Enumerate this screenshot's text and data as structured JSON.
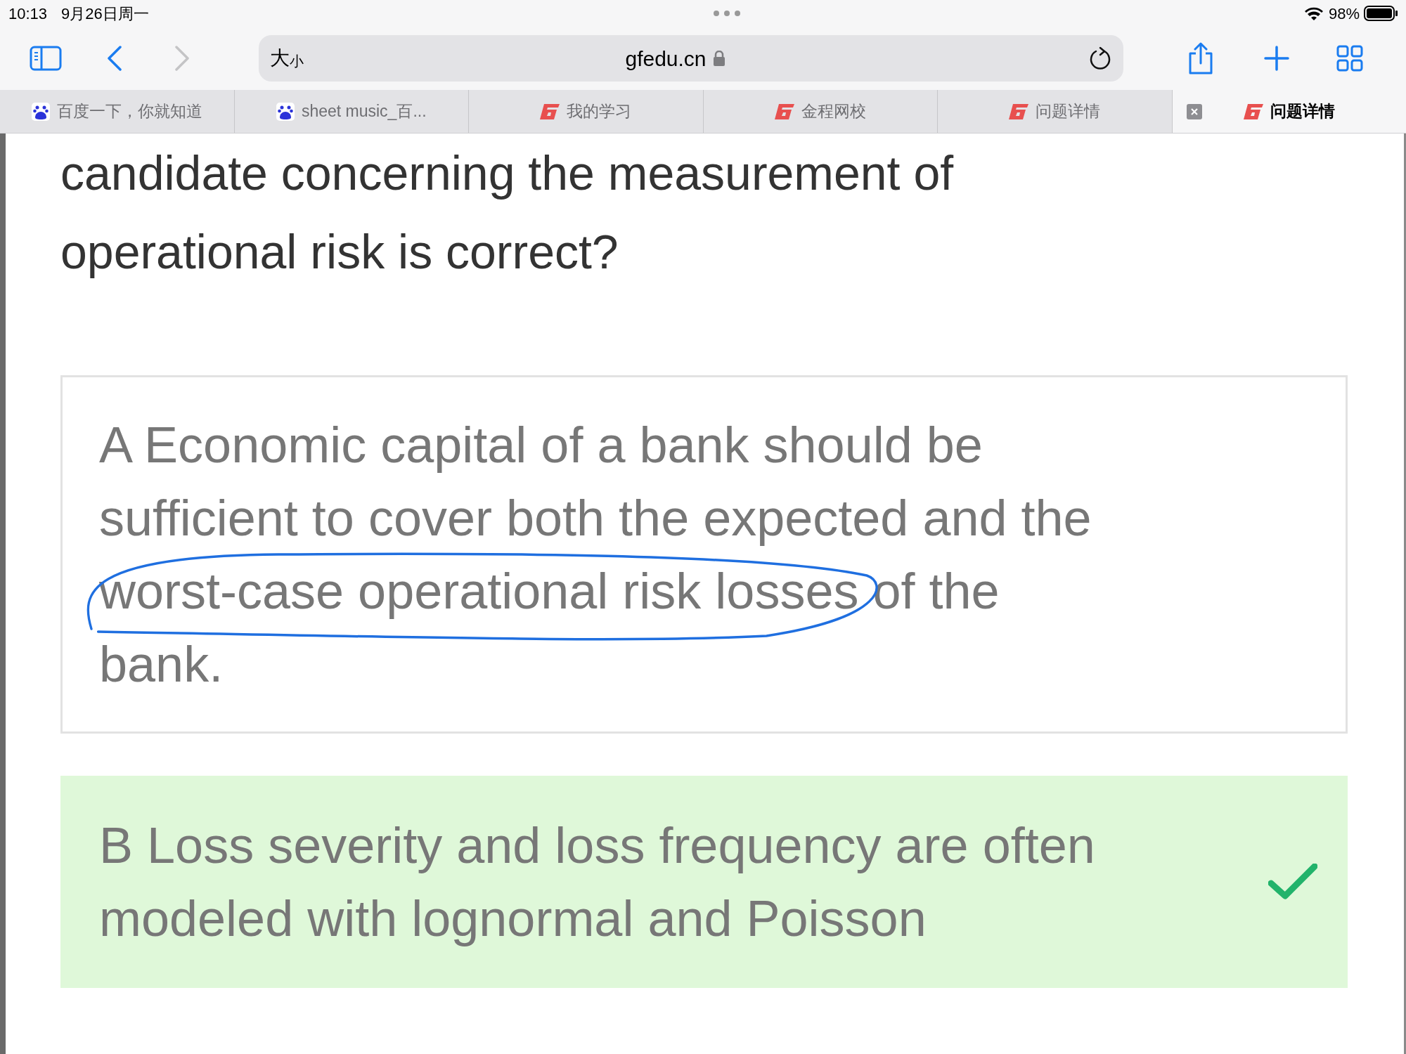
{
  "status_bar": {
    "time": "10:13",
    "date": "9月26日周一",
    "battery": "98%"
  },
  "toolbar": {
    "text_size_large": "大",
    "text_size_small": "小",
    "url": "gfedu.cn",
    "forward_disabled": true
  },
  "tabs": [
    {
      "title": "百度一下，你就知道",
      "kind": "paw",
      "selected": false
    },
    {
      "title": "sheet music_百...",
      "kind": "paw",
      "selected": false
    },
    {
      "title": "我的学习",
      "kind": "logo",
      "selected": false
    },
    {
      "title": "金程网校",
      "kind": "logo",
      "selected": false
    },
    {
      "title": "问题详情",
      "kind": "logo",
      "selected": false
    },
    {
      "title": "问题详情",
      "kind": "logo",
      "selected": true
    }
  ],
  "question": {
    "text": "candidate concerning the measurement of operational risk is correct?"
  },
  "options": [
    {
      "letter": "A",
      "correct": false,
      "segments": [
        {
          "text": "Economic capital of a bank should be sufficient to cover both the expected and the ",
          "circled": false
        },
        {
          "text": "worst-case operational risk losses",
          "circled": true
        },
        {
          "text": " of the bank.",
          "circled": false
        }
      ]
    },
    {
      "letter": "B",
      "correct": true,
      "segments": [
        {
          "text": "Loss severity and loss frequency are often modeled with lognormal and Poisson",
          "circled": false
        }
      ]
    }
  ]
}
